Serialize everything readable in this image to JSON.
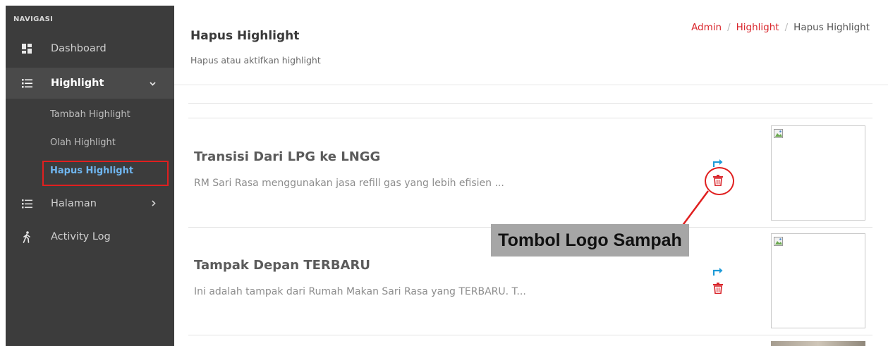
{
  "sidebar": {
    "heading": "NAVIGASI",
    "items": [
      {
        "label": "Dashboard",
        "icon": "dashboard-icon"
      },
      {
        "label": "Highlight",
        "icon": "list-icon",
        "active": true,
        "expanded": true
      },
      {
        "label": "Halaman",
        "icon": "list-icon"
      },
      {
        "label": "Activity Log",
        "icon": "walking-icon"
      }
    ],
    "subitems": [
      {
        "label": "Tambah Highlight"
      },
      {
        "label": "Olah Highlight"
      },
      {
        "label": "Hapus Highlight",
        "current": true
      }
    ]
  },
  "header": {
    "title": "Hapus Highlight",
    "subtitle": "Hapus atau aktifkan highlight",
    "breadcrumb": [
      "Admin",
      "Highlight",
      "Hapus Highlight"
    ]
  },
  "highlights": [
    {
      "title": "Transisi Dari LPG ke LNGG",
      "description": "RM Sari Rasa menggunakan jasa refill gas yang lebih efisien ..."
    },
    {
      "title": "Tampak Depan TERBARU",
      "description": "Ini adalah tampak dari Rumah Makan Sari Rasa yang TERBARU. T..."
    }
  ],
  "annotation": {
    "label": "Tombol Logo Sampah"
  },
  "colors": {
    "sidebar_bg": "#3c3c3c",
    "active_bg": "#4a4a4a",
    "accent_blue": "#1e9bd8",
    "accent_red": "#d9262c",
    "annotation_red": "#e01f1f",
    "current_sub": "#6fb6f0"
  }
}
